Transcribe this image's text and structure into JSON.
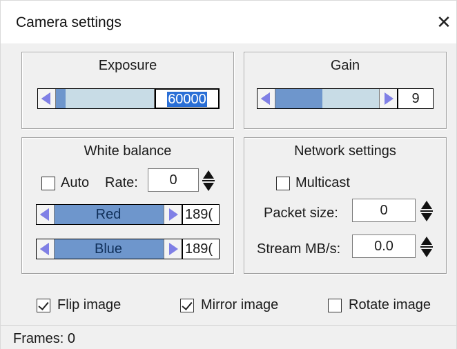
{
  "window": {
    "title": "Camera settings",
    "close_glyph": "✕"
  },
  "exposure": {
    "label": "Exposure",
    "value": "60000",
    "level": 0.1
  },
  "gain": {
    "label": "Gain",
    "value": "9",
    "level": 0.45
  },
  "white_balance": {
    "label": "White balance",
    "auto_label": "Auto",
    "auto_checked": false,
    "rate_label": "Rate:",
    "rate_value": "0",
    "red": {
      "label": "Red",
      "value": "189("
    },
    "blue": {
      "label": "Blue",
      "value": "189("
    }
  },
  "network": {
    "label": "Network settings",
    "multicast_label": "Multicast",
    "multicast_checked": false,
    "packet_label": "Packet size:",
    "packet_value": "0",
    "stream_label": "Stream MB/s:",
    "stream_value": "0.0"
  },
  "options": {
    "flip_label": "Flip image",
    "flip_checked": true,
    "mirror_label": "Mirror image",
    "mirror_checked": true,
    "rotate_label": "Rotate image",
    "rotate_checked": false
  },
  "status": {
    "frames_text": "Frames: 0"
  },
  "colors": {
    "slider_fill": "#6e96cc",
    "slider_track": "#c8dce6",
    "arrow": "#8080e6",
    "selection": "#2a6fd6"
  },
  "icons": {
    "close": "close-icon",
    "arrow_left": "arrow-left-icon",
    "arrow_right": "arrow-right-icon",
    "spin": "spin-updown-icon",
    "check": "checkmark-icon"
  }
}
